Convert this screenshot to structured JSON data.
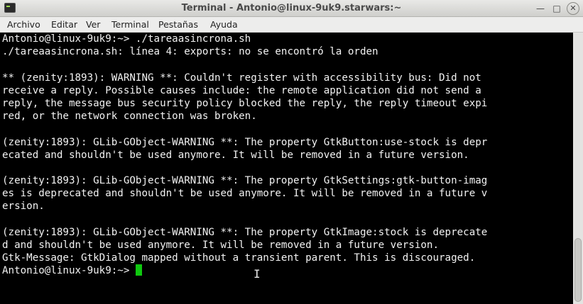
{
  "window": {
    "title": "Terminal - Antonio@linux-9uk9.starwars:~",
    "minimize_glyph": "—",
    "maximize_glyph": "□",
    "close_glyph": "✕"
  },
  "menubar": {
    "items": [
      "Archivo",
      "Editar",
      "Ver",
      "Terminal",
      "Pestañas",
      "Ayuda"
    ]
  },
  "terminal": {
    "lines": [
      "Antonio@linux-9uk9:~> ./tareaasincrona.sh",
      "./tareaasincrona.sh: línea 4: exports: no se encontró la orden",
      "",
      "** (zenity:1893): WARNING **: Couldn't register with accessibility bus: Did not",
      "receive a reply. Possible causes include: the remote application did not send a",
      "reply, the message bus security policy blocked the reply, the reply timeout expi",
      "red, or the network connection was broken.",
      "",
      "(zenity:1893): GLib-GObject-WARNING **: The property GtkButton:use-stock is depr",
      "ecated and shouldn't be used anymore. It will be removed in a future version.",
      "",
      "(zenity:1893): GLib-GObject-WARNING **: The property GtkSettings:gtk-button-imag",
      "es is deprecated and shouldn't be used anymore. It will be removed in a future v",
      "ersion.",
      "",
      "(zenity:1893): GLib-GObject-WARNING **: The property GtkImage:stock is deprecate",
      "d and shouldn't be used anymore. It will be removed in a future version.",
      "Gtk-Message: GtkDialog mapped without a transient parent. This is discouraged."
    ],
    "prompt": "Antonio@linux-9uk9:~> ",
    "cursor_color": "#0fc80f"
  }
}
